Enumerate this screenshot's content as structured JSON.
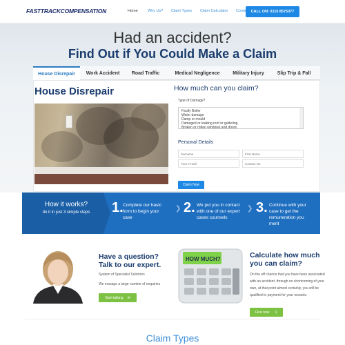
{
  "header": {
    "logo_part1": "FASTTRACK",
    "logo_part2": "COMPENSATION",
    "nav": [
      "Home",
      "Why Us?",
      "Claim Types",
      "Claim Calculator",
      "Contact us"
    ],
    "call": "CALL ON: 0115 8575377"
  },
  "hero": {
    "line1": "Had an accident?",
    "line2": "Find Out if You Could Make a Claim"
  },
  "tabs": [
    "House Disrepair",
    "Work Accident",
    "Road Traffic",
    "Medical Negligence",
    "Military Injury",
    "Slip Trip & Fall"
  ],
  "panel": {
    "title": "House Disrepair",
    "form_title": "How much can you claim?",
    "damage_label": "Type of Damage?",
    "damage_options": [
      "Faulty Boiler",
      "Water damage",
      "Damp or mould",
      "Damaged or leaking roof or guttering",
      "Broken or rotten windows and doors"
    ],
    "personal_title": "Personal Details",
    "placeholders": {
      "surname": "Surname",
      "first": "First Name",
      "email": "Your e-mail",
      "contact": "Contact No"
    },
    "submit": "Claim Now"
  },
  "how": {
    "title": "How it works?",
    "subtitle": "do it in just 3 simple steps",
    "steps": [
      {
        "n": "1.",
        "text": "Complete our basic form to begin your case"
      },
      {
        "n": "2.",
        "text": "We put you in contact with one of our expert cases counsels"
      },
      {
        "n": "3.",
        "text": "Continue with your case to get the remuneration you merit"
      }
    ]
  },
  "question": {
    "title1": "Have a question?",
    "title2": "Talk to our expert.",
    "line1": "System of Specialist Solicitors",
    "line2": "We manage a large number of enquiries",
    "button": "Start talking"
  },
  "calc": {
    "title1": "Calculate how much",
    "title2": "you can claim?",
    "text": "On the off chance that you have been associated with an accident, through no shortcoming of your own, at that point almost certainly, you will be qualified to payment for your wounds.",
    "button": "Find now",
    "screen": "HOW MUCH?"
  },
  "footer_heading": "Claim Types",
  "colors": {
    "accent": "#1e88e5",
    "navy": "#1a3c6d",
    "band": "#1f6fc1",
    "green": "#7cc142"
  }
}
